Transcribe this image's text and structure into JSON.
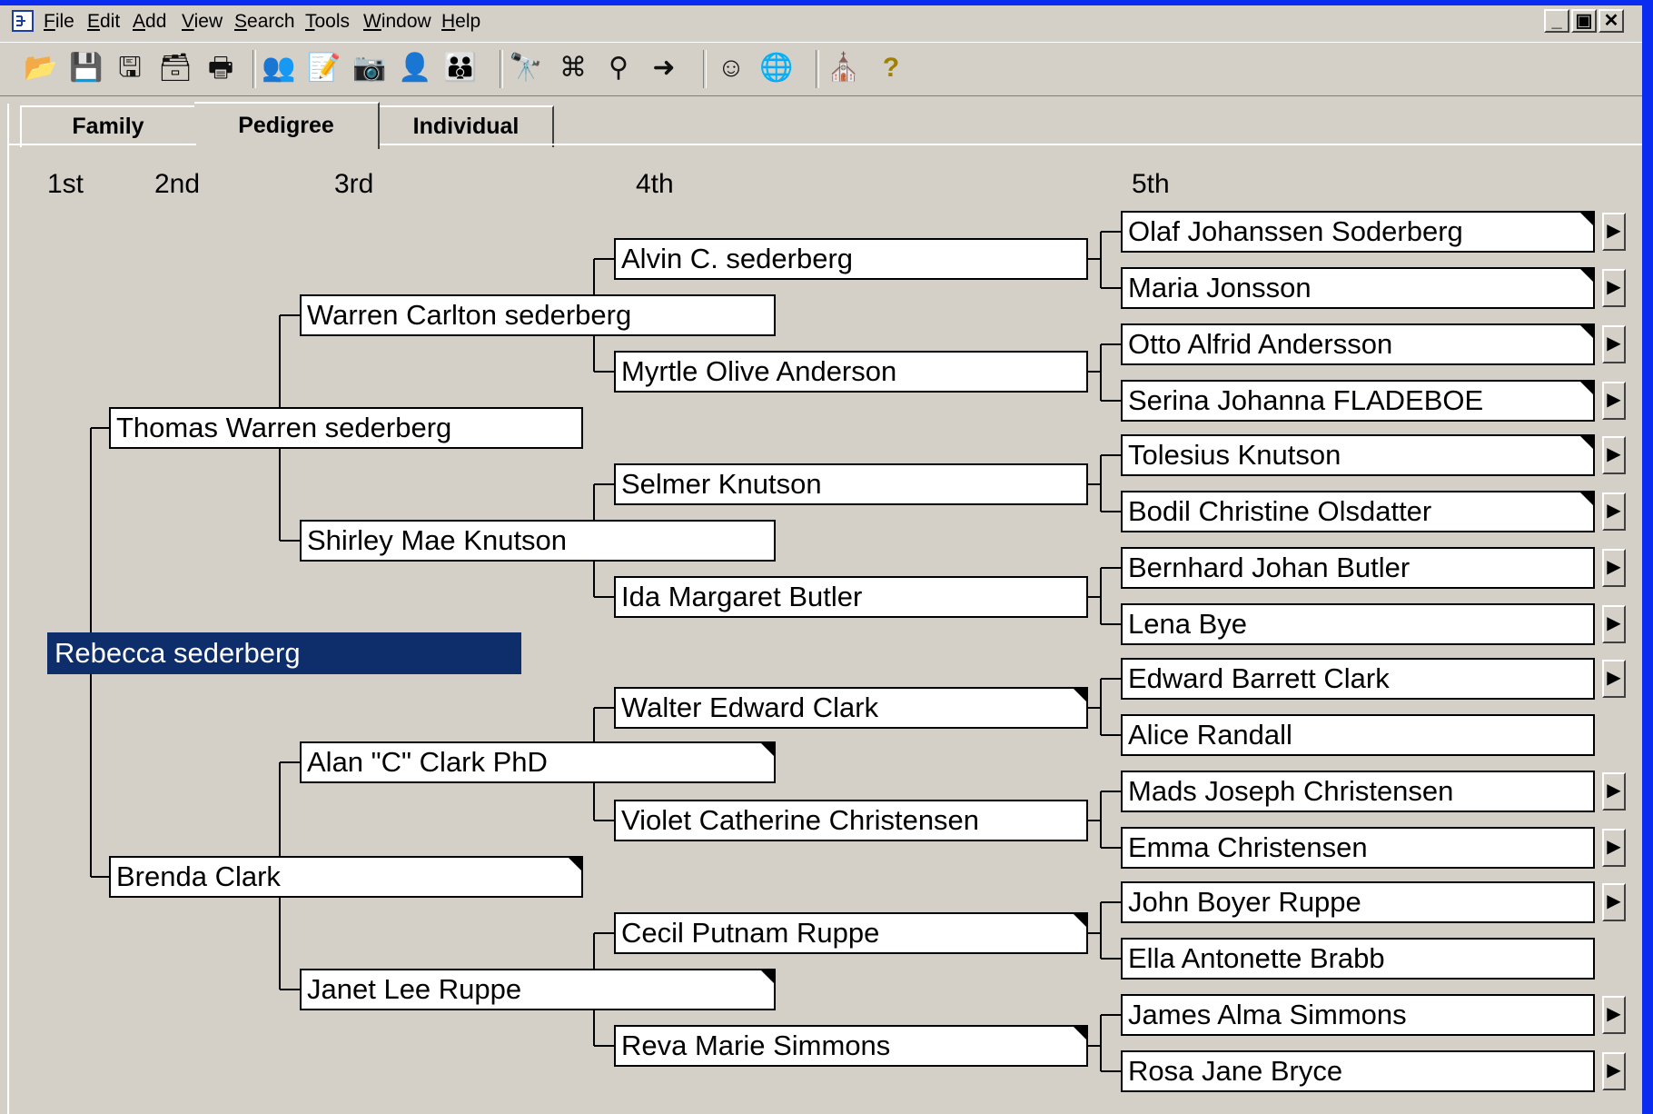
{
  "menu": [
    "File",
    "Edit",
    "Add",
    "View",
    "Search",
    "Tools",
    "Window",
    "Help"
  ],
  "menu_underline": [
    "F",
    "E",
    "A",
    "V",
    "S",
    "T",
    "W",
    "H"
  ],
  "window_buttons": [
    "_",
    "▣",
    "✕"
  ],
  "toolbar_icons": [
    "open-folder-icon",
    "save-icon",
    "save-as-icon",
    "export-icon",
    "print-icon",
    "people-icon",
    "notes-icon",
    "camera-icon",
    "add-individual-icon",
    "add-family-icon",
    "binoculars-icon",
    "find-group-icon",
    "find-relatives-icon",
    "goto-person-icon",
    "person-lookup-icon",
    "globe-icon",
    "church-icon",
    "help-icon"
  ],
  "toolbar_glyphs": [
    "📂",
    "💾",
    "🖫",
    "🗃",
    "🖶",
    "👥",
    "📝",
    "📷",
    "👤",
    "👪",
    "🔭",
    "⌘",
    "⚲",
    "➜",
    "☺",
    "🌐",
    "⛪",
    "?"
  ],
  "tabs": [
    "Family",
    "Pedigree",
    "Individual"
  ],
  "generations": [
    "1st",
    "2nd",
    "3rd",
    "4th",
    "5th"
  ],
  "pedigree": {
    "gen1": [
      "Rebecca sederberg"
    ],
    "gen2": [
      "Thomas Warren sederberg",
      "Brenda Clark"
    ],
    "gen3": [
      "Warren Carlton sederberg",
      "Shirley Mae Knutson",
      "Alan \"C\" Clark PhD",
      "Janet Lee Ruppe"
    ],
    "gen4": [
      "Alvin C. sederberg",
      "Myrtle Olive Anderson",
      "Selmer Knutson",
      "Ida Margaret Butler",
      "Walter Edward Clark",
      "Violet Catherine Christensen",
      "Cecil Putnam Ruppe",
      "Reva Marie Simmons"
    ],
    "gen5": [
      "Olaf Johanssen Soderberg",
      "Maria Jonsson",
      "Otto Alfrid Andersson",
      "Serina Johanna FLADEBOE",
      "Tolesius Knutson",
      "Bodil Christine Olsdatter",
      "Bernhard Johan Butler",
      "Lena Bye",
      "Edward Barrett Clark",
      "Alice Randall",
      "Mads Joseph Christensen",
      "Emma Christensen",
      "John Boyer Ruppe",
      "Ella Antonette Brabb",
      "James Alma Simmons",
      "Rosa Jane Bryce"
    ]
  },
  "more_ancestors_arrow": "▶"
}
